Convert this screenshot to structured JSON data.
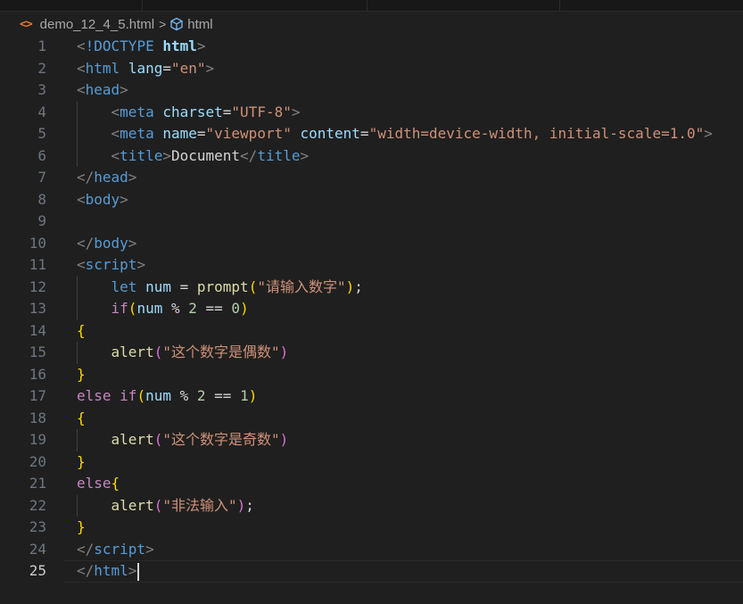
{
  "breadcrumb": {
    "file_icon": "<>",
    "file_name": "demo_12_4_5.html",
    "separator": ">",
    "element_icon": "symbol-element-icon",
    "element": "html"
  },
  "editor": {
    "current_line": 25,
    "lines": [
      {
        "n": "1",
        "tokens": [
          {
            "t": "<",
            "c": "t-br"
          },
          {
            "t": "!DOCTYPE",
            "c": "t-dt"
          },
          {
            "t": " ",
            "c": "t-txt"
          },
          {
            "t": "html",
            "c": "t-at t-bold"
          },
          {
            "t": ">",
            "c": "t-br"
          }
        ]
      },
      {
        "n": "2",
        "tokens": [
          {
            "t": "<",
            "c": "t-br"
          },
          {
            "t": "html",
            "c": "t-tag"
          },
          {
            "t": " ",
            "c": "t-txt"
          },
          {
            "t": "lang",
            "c": "t-at"
          },
          {
            "t": "=",
            "c": "t-txt"
          },
          {
            "t": "\"en\"",
            "c": "t-str"
          },
          {
            "t": ">",
            "c": "t-br"
          }
        ]
      },
      {
        "n": "3",
        "tokens": [
          {
            "t": "<",
            "c": "t-br"
          },
          {
            "t": "head",
            "c": "t-tag"
          },
          {
            "t": ">",
            "c": "t-br"
          }
        ]
      },
      {
        "n": "4",
        "tokens": [
          {
            "t": "    ",
            "c": "t-txt"
          },
          {
            "t": "<",
            "c": "t-br"
          },
          {
            "t": "meta",
            "c": "t-tag"
          },
          {
            "t": " ",
            "c": "t-txt"
          },
          {
            "t": "charset",
            "c": "t-at"
          },
          {
            "t": "=",
            "c": "t-txt"
          },
          {
            "t": "\"UTF-8\"",
            "c": "t-str"
          },
          {
            "t": ">",
            "c": "t-br"
          }
        ]
      },
      {
        "n": "5",
        "tokens": [
          {
            "t": "    ",
            "c": "t-txt"
          },
          {
            "t": "<",
            "c": "t-br"
          },
          {
            "t": "meta",
            "c": "t-tag"
          },
          {
            "t": " ",
            "c": "t-txt"
          },
          {
            "t": "name",
            "c": "t-at"
          },
          {
            "t": "=",
            "c": "t-txt"
          },
          {
            "t": "\"viewport\"",
            "c": "t-str"
          },
          {
            "t": " ",
            "c": "t-txt"
          },
          {
            "t": "content",
            "c": "t-at"
          },
          {
            "t": "=",
            "c": "t-txt"
          },
          {
            "t": "\"width=device-width, initial-scale=1.0\"",
            "c": "t-str"
          },
          {
            "t": ">",
            "c": "t-br"
          }
        ]
      },
      {
        "n": "6",
        "tokens": [
          {
            "t": "    ",
            "c": "t-txt"
          },
          {
            "t": "<",
            "c": "t-br"
          },
          {
            "t": "title",
            "c": "t-tag"
          },
          {
            "t": ">",
            "c": "t-br"
          },
          {
            "t": "Document",
            "c": "t-txt"
          },
          {
            "t": "</",
            "c": "t-br"
          },
          {
            "t": "title",
            "c": "t-tag"
          },
          {
            "t": ">",
            "c": "t-br"
          }
        ]
      },
      {
        "n": "7",
        "tokens": [
          {
            "t": "</",
            "c": "t-br"
          },
          {
            "t": "head",
            "c": "t-tag"
          },
          {
            "t": ">",
            "c": "t-br"
          }
        ]
      },
      {
        "n": "8",
        "tokens": [
          {
            "t": "<",
            "c": "t-br"
          },
          {
            "t": "body",
            "c": "t-tag"
          },
          {
            "t": ">",
            "c": "t-br"
          }
        ]
      },
      {
        "n": "9",
        "tokens": []
      },
      {
        "n": "10",
        "tokens": [
          {
            "t": "</",
            "c": "t-br"
          },
          {
            "t": "body",
            "c": "t-tag"
          },
          {
            "t": ">",
            "c": "t-br"
          }
        ]
      },
      {
        "n": "11",
        "tokens": [
          {
            "t": "<",
            "c": "t-br"
          },
          {
            "t": "script",
            "c": "t-tag"
          },
          {
            "t": ">",
            "c": "t-br"
          }
        ]
      },
      {
        "n": "12",
        "tokens": [
          {
            "t": "    ",
            "c": "t-txt"
          },
          {
            "t": "let",
            "c": "t-kw"
          },
          {
            "t": " ",
            "c": "t-txt"
          },
          {
            "t": "num",
            "c": "t-var"
          },
          {
            "t": " = ",
            "c": "t-op"
          },
          {
            "t": "prompt",
            "c": "t-fn"
          },
          {
            "t": "(",
            "c": "t-p1"
          },
          {
            "t": "\"请输入数字\"",
            "c": "t-str"
          },
          {
            "t": ")",
            "c": "t-p1"
          },
          {
            "t": ";",
            "c": "t-op"
          }
        ]
      },
      {
        "n": "13",
        "tokens": [
          {
            "t": "    ",
            "c": "t-txt"
          },
          {
            "t": "if",
            "c": "t-ctl"
          },
          {
            "t": "(",
            "c": "t-p1"
          },
          {
            "t": "num",
            "c": "t-var"
          },
          {
            "t": " % ",
            "c": "t-op"
          },
          {
            "t": "2",
            "c": "t-num"
          },
          {
            "t": " == ",
            "c": "t-op"
          },
          {
            "t": "0",
            "c": "t-num"
          },
          {
            "t": ")",
            "c": "t-p1"
          }
        ]
      },
      {
        "n": "14",
        "tokens": [
          {
            "t": "{",
            "c": "t-p1"
          }
        ]
      },
      {
        "n": "15",
        "tokens": [
          {
            "t": "    ",
            "c": "t-txt"
          },
          {
            "t": "alert",
            "c": "t-fn"
          },
          {
            "t": "(",
            "c": "t-p2"
          },
          {
            "t": "\"这个数字是偶数\"",
            "c": "t-str"
          },
          {
            "t": ")",
            "c": "t-p2"
          }
        ]
      },
      {
        "n": "16",
        "tokens": [
          {
            "t": "}",
            "c": "t-p1"
          }
        ]
      },
      {
        "n": "17",
        "tokens": [
          {
            "t": "else",
            "c": "t-ctl"
          },
          {
            "t": " ",
            "c": "t-txt"
          },
          {
            "t": "if",
            "c": "t-ctl"
          },
          {
            "t": "(",
            "c": "t-p1"
          },
          {
            "t": "num",
            "c": "t-var"
          },
          {
            "t": " % ",
            "c": "t-op"
          },
          {
            "t": "2",
            "c": "t-num"
          },
          {
            "t": " == ",
            "c": "t-op"
          },
          {
            "t": "1",
            "c": "t-num"
          },
          {
            "t": ")",
            "c": "t-p1"
          }
        ]
      },
      {
        "n": "18",
        "tokens": [
          {
            "t": "{",
            "c": "t-p1"
          }
        ]
      },
      {
        "n": "19",
        "tokens": [
          {
            "t": "    ",
            "c": "t-txt"
          },
          {
            "t": "alert",
            "c": "t-fn"
          },
          {
            "t": "(",
            "c": "t-p2"
          },
          {
            "t": "\"这个数字是奇数\"",
            "c": "t-str"
          },
          {
            "t": ")",
            "c": "t-p2"
          }
        ]
      },
      {
        "n": "20",
        "tokens": [
          {
            "t": "}",
            "c": "t-p1"
          }
        ]
      },
      {
        "n": "21",
        "tokens": [
          {
            "t": "else",
            "c": "t-ctl"
          },
          {
            "t": "{",
            "c": "t-p1"
          }
        ]
      },
      {
        "n": "22",
        "tokens": [
          {
            "t": "    ",
            "c": "t-txt"
          },
          {
            "t": "alert",
            "c": "t-fn"
          },
          {
            "t": "(",
            "c": "t-p2"
          },
          {
            "t": "\"非法输入\"",
            "c": "t-str"
          },
          {
            "t": ")",
            "c": "t-p2"
          },
          {
            "t": ";",
            "c": "t-op"
          }
        ]
      },
      {
        "n": "23",
        "tokens": [
          {
            "t": "}",
            "c": "t-p1"
          }
        ]
      },
      {
        "n": "24",
        "tokens": [
          {
            "t": "</",
            "c": "t-br"
          },
          {
            "t": "script",
            "c": "t-tag"
          },
          {
            "t": ">",
            "c": "t-br"
          }
        ]
      },
      {
        "n": "25",
        "tokens": [
          {
            "t": "</",
            "c": "t-br"
          },
          {
            "t": "html",
            "c": "t-tag"
          },
          {
            "t": ">",
            "c": "t-br"
          }
        ]
      }
    ]
  }
}
